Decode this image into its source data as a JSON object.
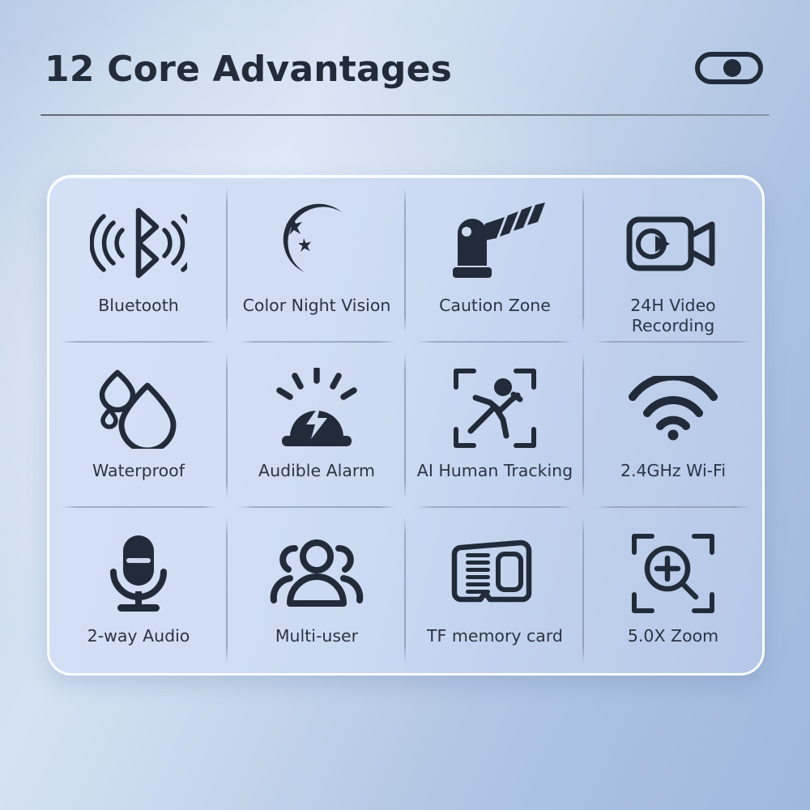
{
  "header": {
    "title": "12 Core Advantages",
    "toggle_icon": "toggle-switch-icon",
    "toggle_state": "on"
  },
  "colors": {
    "background_light": "#d5e2f4",
    "background_dark": "#9fb8dc",
    "card_light": "#d4e0f6",
    "card_dark": "#b5c8e7",
    "card_border": "#ffffff",
    "icon": "#222b3a",
    "text": "#2b3444",
    "divider": "#8c9bb4"
  },
  "card": {
    "columns": 4,
    "rows": 3,
    "items": [
      {
        "icon": "bluetooth-icon",
        "label": "Bluetooth"
      },
      {
        "icon": "crescent-moon-stars-icon",
        "label": "Color Night Vision"
      },
      {
        "icon": "barrier-gate-icon",
        "label": "Caution Zone"
      },
      {
        "icon": "video-camera-icon",
        "label": "24H Video\nRecording"
      },
      {
        "icon": "water-drops-icon",
        "label": "Waterproof"
      },
      {
        "icon": "alarm-siren-icon",
        "label": "Audible Alarm"
      },
      {
        "icon": "human-tracking-icon",
        "label": "AI Human Tracking"
      },
      {
        "icon": "wifi-icon",
        "label": "2.4GHz Wi-Fi"
      },
      {
        "icon": "microphone-icon",
        "label": "2-way Audio"
      },
      {
        "icon": "users-group-icon",
        "label": "Multi-user"
      },
      {
        "icon": "memory-card-icon",
        "label": "TF memory card"
      },
      {
        "icon": "zoom-magnifier-icon",
        "label": "5.0X Zoom"
      }
    ]
  }
}
